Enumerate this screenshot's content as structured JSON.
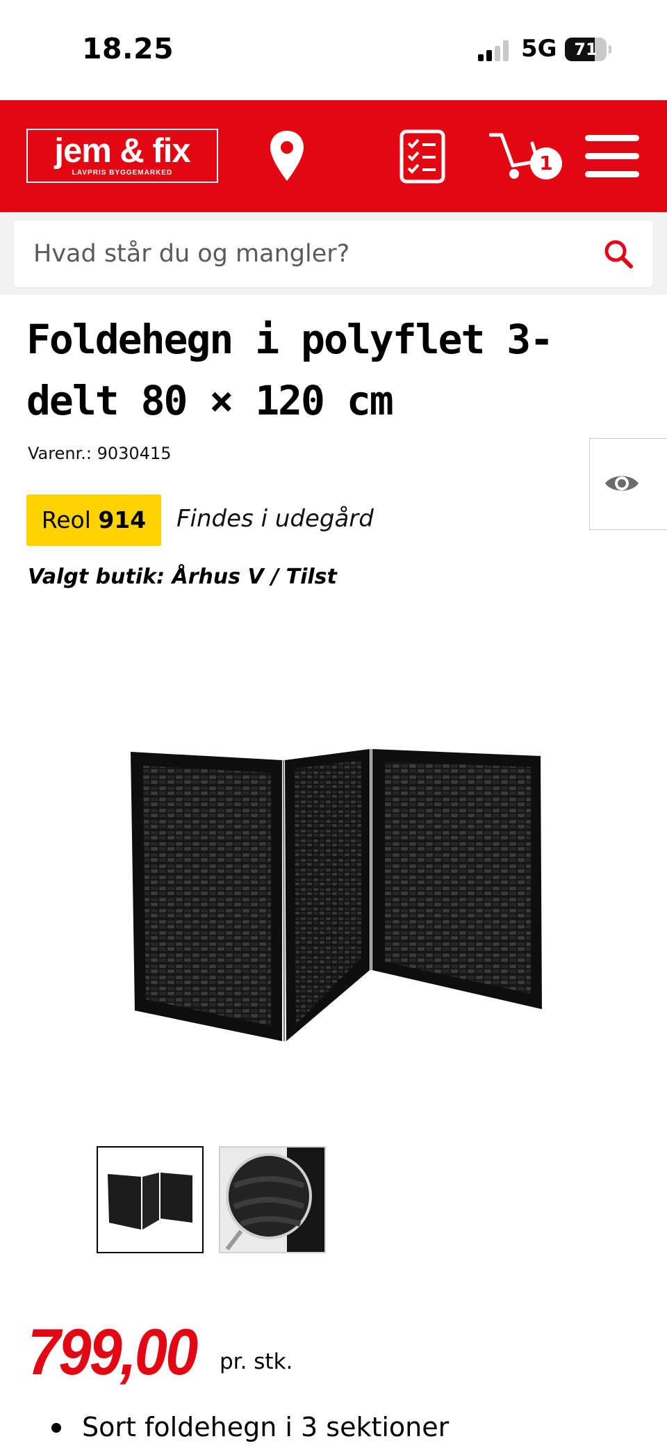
{
  "status_bar": {
    "time": "18.25",
    "network": "5G",
    "battery_percent": 71,
    "battery_label": "71",
    "signal_bars_active": 2,
    "signal_bars_total": 4
  },
  "header": {
    "logo_name": "jem & fix",
    "logo_tagline": "LAVPRIS BYGGEMARKED",
    "cart_count": "1",
    "brand_color": "#e30613",
    "icons": [
      "store-locator-icon",
      "shopping-list-icon",
      "cart-icon",
      "menu-icon"
    ]
  },
  "search": {
    "placeholder": "Hvad står du og mangler?"
  },
  "product": {
    "title": "Foldehegn i polyflet 3-delt 80 × 120 cm",
    "sku_label": "Varenr.: 9030415",
    "shelf_label": "Reol",
    "shelf_number": "914",
    "location": "Findes i udegård",
    "store": "Valgt butik: Århus V / Tilst",
    "thumbnails": [
      "product-thumbnail-folding-screen",
      "product-thumbnail-weave-detail"
    ],
    "price": "799,00",
    "price_unit": "pr. stk.",
    "price_color": "#e30613",
    "features": [
      "Sort foldehegn i 3 sektioner"
    ]
  }
}
